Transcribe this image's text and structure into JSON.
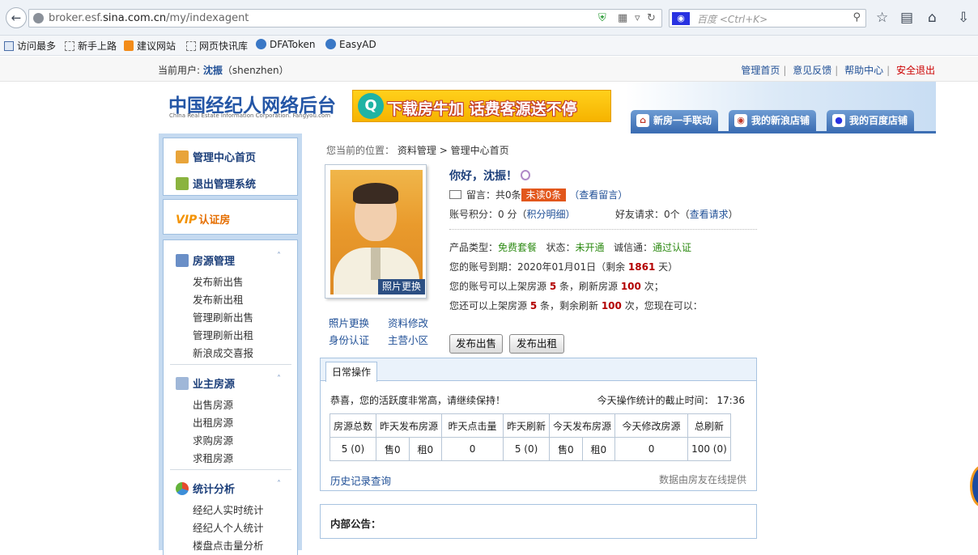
{
  "browser": {
    "url_host": "broker.esf.",
    "url_domain": "sina.com.cn",
    "url_path": "/my/indexagent",
    "search_placeholder": "百度 <Ctrl+K>"
  },
  "bookmarks": [
    "访问最多",
    "新手上路",
    "建议网站",
    "网页快讯库",
    "DFAToken",
    "EasyAD"
  ],
  "userbar": {
    "label": "当前用户:",
    "name": "沈振",
    "login": "（shenzhen）",
    "links": [
      "管理首页",
      "意见反馈",
      "帮助中心",
      "安全退出"
    ]
  },
  "header": {
    "logo_cn": "中国经纪人网络后台",
    "logo_en": "China Real Estate Information Corporation. Fangyou.com",
    "ad_text": "下载房牛加  话费客源送不停",
    "tabs": [
      "新房一手联动",
      "我的新浪店铺",
      "我的百度店铺"
    ]
  },
  "sidebar": {
    "top_items": [
      "管理中心首页",
      "退出管理系统"
    ],
    "vip_label": "VIP",
    "vip_text": "认证房",
    "sections": [
      {
        "title": "房源管理",
        "items": [
          "发布新出售",
          "发布新出租",
          "管理刷新出售",
          "管理刷新出租",
          "新浪成交喜报"
        ]
      },
      {
        "title": "业主房源",
        "items": [
          "出售房源",
          "出租房源",
          "求购房源",
          "求租房源"
        ]
      },
      {
        "title": "统计分析",
        "items": [
          "经纪人实时统计",
          "经纪人个人统计",
          "楼盘点击量分析"
        ]
      }
    ]
  },
  "breadcrumb": {
    "prefix": "您当前的位置：",
    "items": [
      "资料管理",
      ">",
      "管理中心首页"
    ]
  },
  "profile": {
    "photo_button": "照片更换",
    "links": [
      "照片更换",
      "资料修改",
      "身份认证",
      "主营小区"
    ],
    "greeting": "你好，沈振！",
    "msg_label": "留言：共0条",
    "unread": "未读0条",
    "view_msg": "（查看留言）",
    "points_label": "账号积分：",
    "points": "0 分（",
    "points_link": "积分明细",
    "points_close": "）",
    "friend_label": "好友请求：0个（",
    "friend_link": "查看请求",
    "friend_close": "）",
    "product_label": "产品类型：",
    "product_value": "免费套餐",
    "status_label": "状态：",
    "status_value": "未开通",
    "trust_label": "诚信通：",
    "trust_value": "通过认证",
    "expire_label": "您的账号到期：2020年01月01日（剩余 ",
    "expire_days": "1861",
    "expire_suffix": " 天）",
    "quota1_a": "您的账号可以上架房源 ",
    "quota1_b": "5",
    "quota1_c": " 条，刷新房源 ",
    "quota1_d": "100",
    "quota1_e": " 次；",
    "quota2_a": "您还可以上架房源 ",
    "quota2_b": "5",
    "quota2_c": " 条，剩余刷新 ",
    "quota2_d": "100",
    "quota2_e": " 次，您现在可以：",
    "btn_sell": "发布出售",
    "btn_rent": "发布出租"
  },
  "daily": {
    "tab": "日常操作",
    "message": "恭喜，您的活跃度非常高，请继续保持！",
    "time_label": "今天操作统计的截止时间：",
    "time": "17:36",
    "headers": [
      "房源总数",
      "昨天发布房源",
      "昨天点击量",
      "昨天刷新",
      "今天发布房源",
      "今天修改房源",
      "总刷新"
    ],
    "row": [
      "5 (0)",
      "售0",
      "租0",
      "0",
      "5 (0)",
      "售0",
      "租0",
      "0",
      "100 (0)"
    ],
    "history": "历史记录查询",
    "source": "数据由房友在线提供"
  },
  "notice": {
    "title": "内部公告："
  }
}
